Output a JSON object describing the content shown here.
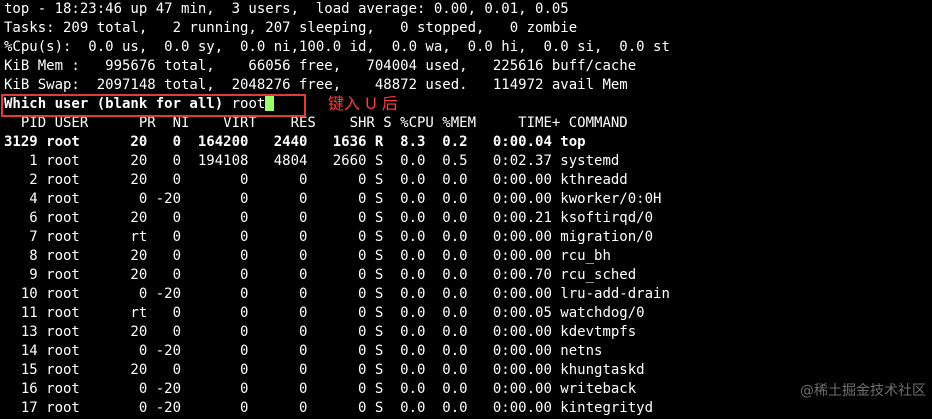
{
  "summary": {
    "line1": "top - 18:23:46 up 47 min,  3 users,  load average: 0.00, 0.01, 0.05",
    "line2": "Tasks: 209 total,   2 running, 207 sleeping,   0 stopped,   0 zombie",
    "line3": "%Cpu(s):  0.0 us,  0.0 sy,  0.0 ni,100.0 id,  0.0 wa,  0.0 hi,  0.0 si,  0.0 st",
    "line4": "KiB Mem :   995676 total,    66056 free,   704004 used,   225616 buff/cache",
    "line5": "KiB Swap:  2097148 total,  2048276 free,    48872 used.   114972 avail Mem"
  },
  "prompt": {
    "label": "Which user (blank for all)",
    "value": " root"
  },
  "annotation": "键入 U 后",
  "watermark": "@稀土掘金技术社区",
  "table": {
    "header": "  PID USER      PR  NI    VIRT    RES    SHR S %CPU %MEM     TIME+ COMMAND",
    "rows": [
      "3129 root      20   0  164200   2440   1636 R  8.3  0.2   0:00.04 top",
      "   1 root      20   0  194108   4804   2660 S  0.0  0.5   0:02.37 systemd",
      "   2 root      20   0       0      0      0 S  0.0  0.0   0:00.00 kthreadd",
      "   4 root       0 -20       0      0      0 S  0.0  0.0   0:00.00 kworker/0:0H",
      "   6 root      20   0       0      0      0 S  0.0  0.0   0:00.21 ksoftirqd/0",
      "   7 root      rt   0       0      0      0 S  0.0  0.0   0:00.00 migration/0",
      "   8 root      20   0       0      0      0 S  0.0  0.0   0:00.00 rcu_bh",
      "   9 root      20   0       0      0      0 S  0.0  0.0   0:00.70 rcu_sched",
      "  10 root       0 -20       0      0      0 S  0.0  0.0   0:00.00 lru-add-drain",
      "  11 root      rt   0       0      0      0 S  0.0  0.0   0:00.05 watchdog/0",
      "  13 root      20   0       0      0      0 S  0.0  0.0   0:00.00 kdevtmpfs",
      "  14 root       0 -20       0      0      0 S  0.0  0.0   0:00.00 netns",
      "  15 root      20   0       0      0      0 S  0.0  0.0   0:00.00 khungtaskd",
      "  16 root       0 -20       0      0      0 S  0.0  0.0   0:00.00 writeback",
      "  17 root       0 -20       0      0      0 S  0.0  0.0   0:00.00 kintegrityd"
    ]
  }
}
